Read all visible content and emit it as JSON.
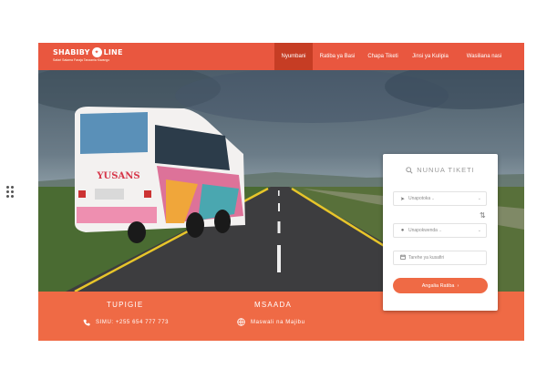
{
  "brand": {
    "name": "SHABIBY",
    "name_suffix": "LINE",
    "tagline": "Safari Salama Faraja Tanzania Kiwango",
    "color_primary": "#e9573f",
    "color_footer": "#ef6a45",
    "color_nav_active": "#c63d24"
  },
  "nav": {
    "items": [
      {
        "label": "Nyumbani",
        "active": true
      },
      {
        "label": "Ratiba ya Basi",
        "active": false
      },
      {
        "label": "Chapa Tiketi",
        "active": false
      },
      {
        "label": "Jinsi ya Kulipia",
        "active": false
      },
      {
        "label": "Wasiliana nasi",
        "active": false
      }
    ]
  },
  "hero": {
    "bus_text": "YUSANS"
  },
  "booking": {
    "title": "NUNUA TIKETI",
    "title_icon": "search-icon",
    "from_placeholder": "Unapotoka ..",
    "to_placeholder": "Unapokwenda ..",
    "date_placeholder": "Tarehe ya kusafiri",
    "swap_icon": "swap-arrows-icon",
    "submit_label": "Angalia Ratiba",
    "submit_icon": "chevron-right-icon"
  },
  "footer": {
    "contact_heading": "TUPIGIE",
    "contact_text": "SIMU: +255 654 777 773",
    "contact_icon": "phone-icon",
    "help_heading": "MSAADA",
    "help_text": "Maswali na Majibu",
    "help_icon": "globe-icon"
  }
}
